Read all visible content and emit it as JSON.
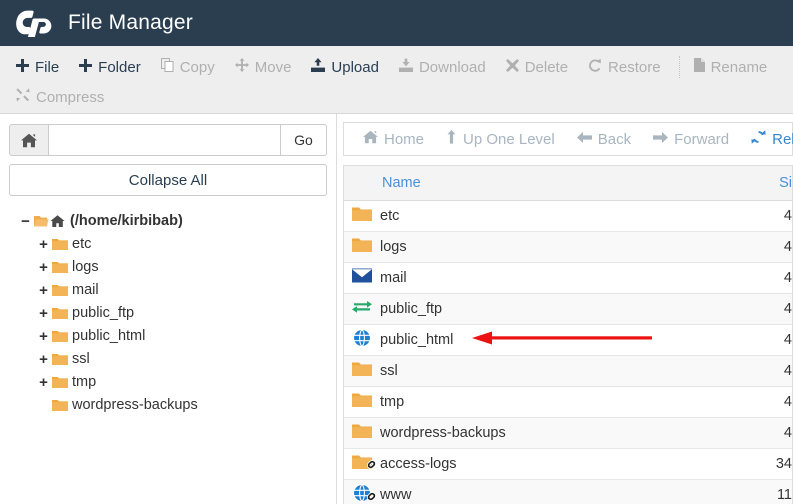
{
  "header": {
    "title": "File Manager",
    "logo_icon": "cpanel-logo-icon"
  },
  "toolbar": {
    "row1": [
      {
        "label": "File",
        "icon": "plus-icon",
        "enabled": true
      },
      {
        "label": "Folder",
        "icon": "plus-icon",
        "enabled": true
      },
      {
        "label": "Copy",
        "icon": "copy-icon",
        "enabled": false
      },
      {
        "label": "Move",
        "icon": "move-icon",
        "enabled": false
      },
      {
        "label": "Upload",
        "icon": "upload-icon",
        "enabled": true
      },
      {
        "label": "Download",
        "icon": "download-icon",
        "enabled": false
      },
      {
        "label": "Delete",
        "icon": "x-icon",
        "enabled": false
      },
      {
        "label": "Restore",
        "icon": "restore-icon",
        "enabled": false
      },
      {
        "label": "Rename",
        "icon": "file-icon",
        "enabled": false
      }
    ],
    "row2": [
      {
        "label": "Compress",
        "icon": "compress-icon",
        "enabled": false
      }
    ]
  },
  "sidebar": {
    "path_input_value": "",
    "path_input_placeholder": "",
    "home_icon": "home-icon",
    "go_label": "Go",
    "collapse_all_label": "Collapse All",
    "tree": {
      "root": {
        "label": "(/home/kirbibab)",
        "expander": "−",
        "icon": "open-folder-home-icon"
      },
      "children": [
        {
          "label": "etc",
          "expander": "+",
          "icon": "folder-icon"
        },
        {
          "label": "logs",
          "expander": "+",
          "icon": "folder-icon"
        },
        {
          "label": "mail",
          "expander": "+",
          "icon": "folder-icon"
        },
        {
          "label": "public_ftp",
          "expander": "+",
          "icon": "folder-icon"
        },
        {
          "label": "public_html",
          "expander": "+",
          "icon": "folder-icon"
        },
        {
          "label": "ssl",
          "expander": "+",
          "icon": "folder-icon"
        },
        {
          "label": "tmp",
          "expander": "+",
          "icon": "folder-icon"
        },
        {
          "label": "wordpress-backups",
          "expander": "",
          "icon": "folder-icon"
        }
      ]
    }
  },
  "main": {
    "nav": [
      {
        "label": "Home",
        "icon": "home-icon",
        "active": false
      },
      {
        "label": "Up One Level",
        "icon": "arrow-up-icon",
        "active": false
      },
      {
        "label": "Back",
        "icon": "arrow-left-icon",
        "active": false
      },
      {
        "label": "Forward",
        "icon": "arrow-right-icon",
        "active": false
      },
      {
        "label": "Reload",
        "icon": "reload-icon",
        "active": true
      }
    ],
    "columns": {
      "name": "Name",
      "size": "Si"
    },
    "rows": [
      {
        "name": "etc",
        "size": "4",
        "icon": "folder-icon",
        "symlink": false
      },
      {
        "name": "logs",
        "size": "4",
        "icon": "folder-icon",
        "symlink": false
      },
      {
        "name": "mail",
        "size": "4",
        "icon": "envelope-icon",
        "symlink": false
      },
      {
        "name": "public_ftp",
        "size": "4",
        "icon": "exchange-icon",
        "symlink": false
      },
      {
        "name": "public_html",
        "size": "4",
        "icon": "globe-icon",
        "symlink": false
      },
      {
        "name": "ssl",
        "size": "4",
        "icon": "folder-icon",
        "symlink": false
      },
      {
        "name": "tmp",
        "size": "4",
        "icon": "folder-icon",
        "symlink": false
      },
      {
        "name": "wordpress-backups",
        "size": "4",
        "icon": "folder-icon",
        "symlink": false
      },
      {
        "name": "access-logs",
        "size": "34",
        "icon": "folder-icon",
        "symlink": true
      },
      {
        "name": "www",
        "size": "11",
        "icon": "globe-icon",
        "symlink": true
      }
    ]
  },
  "annotation": {
    "type": "red-arrow-left",
    "color": "#ee1111",
    "points_at": "public_html"
  },
  "colors": {
    "header_bg": "#2b3e50",
    "toolbar_bg": "#eeeeee",
    "folder": "#f0ad4e",
    "link_blue": "#4a90d9",
    "nav_muted": "#a9b6c0",
    "annotation_red": "#ee1111"
  }
}
